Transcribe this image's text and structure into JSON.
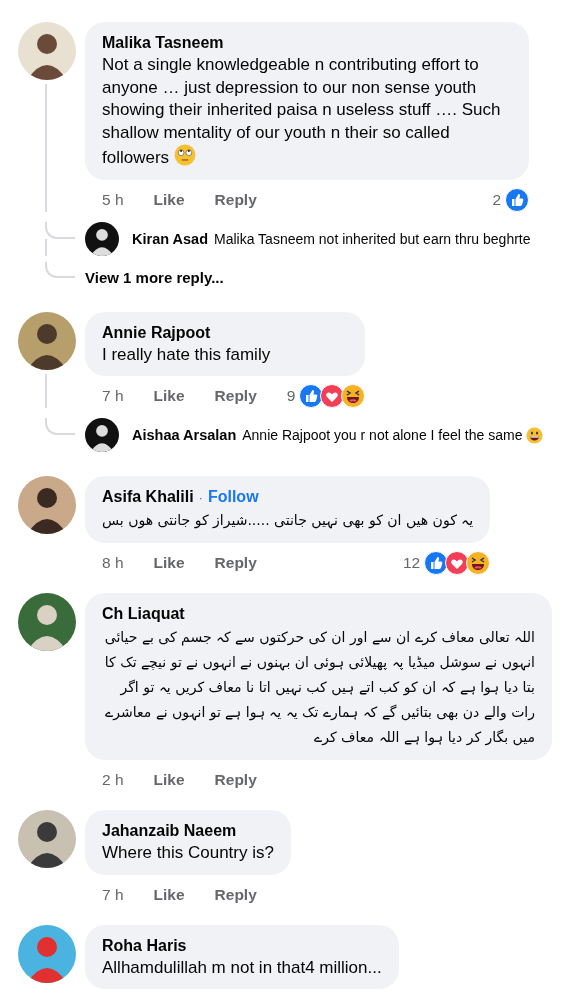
{
  "comments": [
    {
      "author": "Malika Tasneem",
      "text": "Not a single knowledgeable n contributing effort to anyone … just depression to our non sense youth showing their inherited paisa n useless stuff …. Such shallow mentality of our youth n their so called followers",
      "emoji": {
        "kind": "eye-roll"
      },
      "rtl": false,
      "time": "5 h",
      "like": "Like",
      "reply": "Reply",
      "reactions": {
        "count": "2",
        "icons": [
          {
            "kind": "like"
          }
        ]
      },
      "replies": [
        {
          "author": "Kiran Asad",
          "text": "Malika Tasneem not inherited but earn thru beghrte"
        }
      ],
      "more_replies": "View 1 more reply..."
    },
    {
      "author": "Annie Rajpoot",
      "text": "I really hate this family",
      "rtl": false,
      "time": "7 h",
      "like": "Like",
      "reply": "Reply",
      "reactions": {
        "count": "9",
        "icons": [
          {
            "kind": "like"
          },
          {
            "kind": "love"
          },
          {
            "kind": "haha"
          }
        ]
      },
      "replies": [
        {
          "author": "Aishaa Arsalan",
          "text": "Annie Rajpoot you r not alone I feel the same",
          "emoji": {
            "kind": "grin"
          }
        }
      ]
    },
    {
      "author": "Asifa Khalili",
      "follow": {
        "separator": "·",
        "label": "Follow"
      },
      "text": "یہ کون ھیں ان کو بھی نہیں جانتی .....شیراز کو جانتی ھوں بس",
      "rtl": true,
      "time": "8 h",
      "like": "Like",
      "reply": "Reply",
      "reactions": {
        "count": "12",
        "icons": [
          {
            "kind": "like"
          },
          {
            "kind": "love"
          },
          {
            "kind": "haha"
          }
        ]
      }
    },
    {
      "author": "Ch Liaquat",
      "text": "اللہ تعالی معاف کرے ان سے اور ان کی حرکتوں سے کہ جسم کی بے حیائی انہوں نے سوشل میڈیا پہ پھیلائی ہوئی ان بہنوں نے انہوں نے تو نیچے تک کا بتا دیا ہوا ہے کہ ان کو کب اتے ہیں کب نہیں اتا نا معاف کریں یہ تو اگر رات والے دن بھی بتائیں گے کہ ہمارے تک یہ یہ ہوا ہے تو انہوں نے معاشرے میں بگار کر دیا ہوا ہے اللہ معاف کرے",
      "rtl": true,
      "time": "2 h",
      "like": "Like",
      "reply": "Reply"
    },
    {
      "author": "Jahanzaib Naeem",
      "text": "Where this Country is?",
      "rtl": false,
      "time": "7 h",
      "like": "Like",
      "reply": "Reply"
    },
    {
      "author": "Roha Haris",
      "text": "Allhamdulillah  m not in that4 million...",
      "rtl": false
    }
  ]
}
